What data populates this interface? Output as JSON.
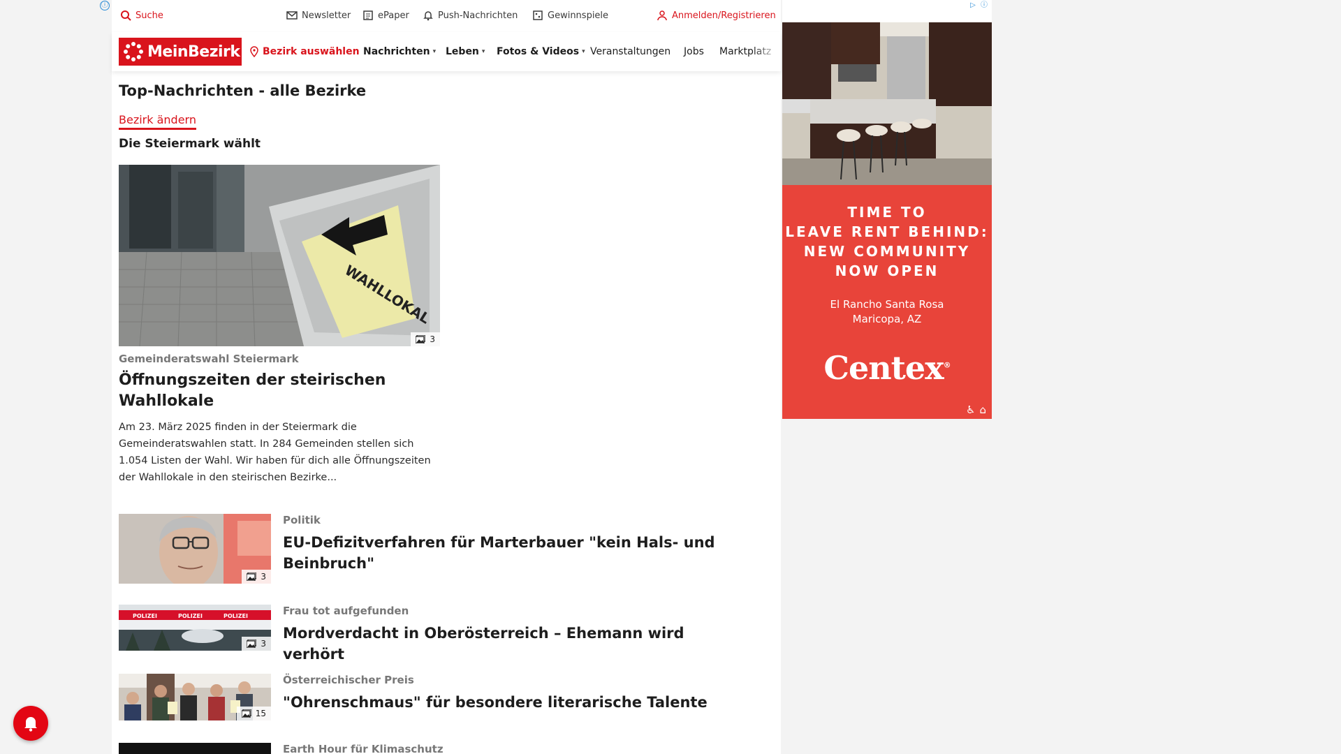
{
  "topbar": {
    "search": "Suche",
    "newsletter": "Newsletter",
    "epaper": "ePaper",
    "push": "Push-Nachrichten",
    "contests": "Gewinnspiele",
    "login": "Anmelden/Registrieren",
    "info_icon": "ⓘ"
  },
  "nav": {
    "logo": "MeinBezirk",
    "district_select": "Bezirk auswählen",
    "items": [
      "Nachrichten",
      "Leben",
      "Fotos & Videos",
      "Veranstaltungen",
      "Jobs",
      "Marktplatz"
    ]
  },
  "main": {
    "page_title": "Top-Nachrichten - alle Bezirke",
    "change_district": "Bezirk ändern",
    "section_title": "Die Steiermark wählt",
    "lead": {
      "photo_count": "3",
      "kicker": "Gemeinderatswahl Steiermark",
      "headline": "Öffnungszeiten der steirischen Wahllokale",
      "teaser": "Am 23. März 2025 finden in der Steiermark die Gemeinderatswahlen statt. In 284 Gemeinden stellen sich 1.054 Listen der Wahl. Wir haben für dich alle Öffnungszeiten der Wahllokale in den steirischen Bezirke...",
      "image_sign_text": "WAHLLOKAL"
    },
    "articles": [
      {
        "kicker": "Politik",
        "headline": "EU-Defizitverfahren für Marterbauer \"kein Hals- und Beinbruch\"",
        "photo_count": "3"
      },
      {
        "kicker": "Frau tot aufgefunden",
        "headline": "Mordverdacht in Oberösterreich – Ehemann wird verhört",
        "photo_count": "3",
        "tape_text": "POLIZEI"
      },
      {
        "kicker": "Österreichischer Preis",
        "headline": "\"Ohrenschmaus\" für besondere literarische Talente",
        "photo_count": "15"
      },
      {
        "kicker": "Earth Hour für Klimaschutz"
      }
    ]
  },
  "ad": {
    "headline_lines": [
      "TIME TO",
      "LEAVE RENT BEHIND:",
      "NEW COMMUNITY",
      "NOW OPEN"
    ],
    "location_lines": [
      "El Rancho Santa Rosa",
      "Maricopa, AZ"
    ],
    "brand": "Centex",
    "brand_mark": "®",
    "choices": [
      "▷",
      "ⓘ"
    ],
    "accent": "#e8443a"
  },
  "colors": {
    "brand_red": "#d9141c",
    "bell_red": "#e30613"
  }
}
